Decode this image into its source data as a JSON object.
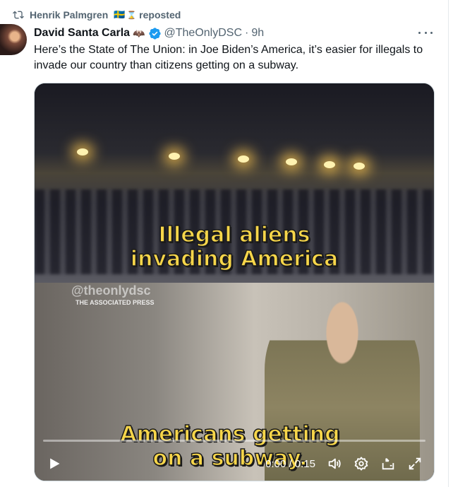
{
  "repost": {
    "user": "Henrik Palmgren",
    "flag": "🇸🇪",
    "suffix": "reposted",
    "hourglass": "⌛"
  },
  "tweet": {
    "name": "David Santa Carla",
    "name_emoji": "🦇",
    "handle": "@TheOnlyDSC",
    "separator": "·",
    "time": "9h",
    "text": "Here’s the State of The Union: in Joe Biden’s America, it’s easier for illegals to invade our country than citizens getting on a subway."
  },
  "video": {
    "caption_top_line1": "Illegal aliens",
    "caption_top_line2": "invading America",
    "caption_bottom_line1": "Americans getting",
    "caption_bottom_line2": "on a subway.",
    "watermark": "@theonlydsc",
    "press_label": "THE ASSOCIATED PRESS",
    "time_display": "0:00 / 0:15",
    "progress": 0
  },
  "colors": {
    "verified": "#1d9bf0",
    "muted": "#536471",
    "caption": "#f7d64a"
  },
  "icons": {
    "repost": "repost-icon",
    "verified": "verified-badge-icon",
    "more": "more-options-icon",
    "play": "play-icon",
    "volume": "volume-icon",
    "settings": "settings-gear-icon",
    "dock": "pop-out-icon",
    "fullscreen": "fullscreen-icon"
  }
}
